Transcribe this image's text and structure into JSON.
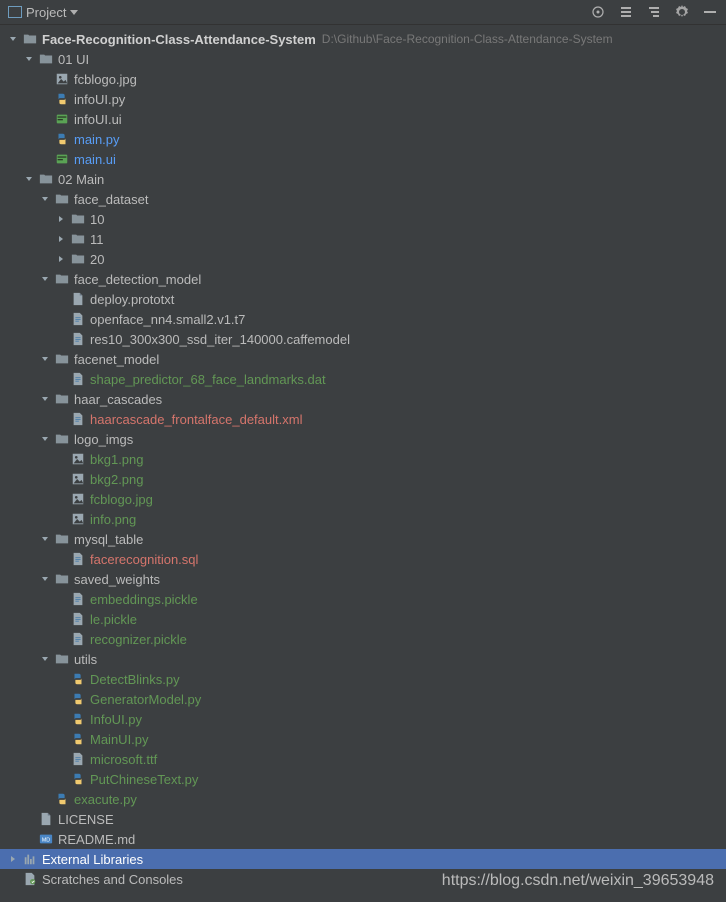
{
  "toolbar": {
    "title": "Project",
    "icons": {
      "target": "target-icon",
      "collapse": "collapse-all-icon",
      "expand": "expand-all-icon",
      "settings": "gear-icon",
      "hide": "hide-icon"
    }
  },
  "watermark": "https://blog.csdn.net/weixin_39653948",
  "tree": [
    {
      "d": 0,
      "exp": "open",
      "icon": "folder",
      "name": "Face-Recognition-Class-Attendance-System",
      "bold": true,
      "hint": "D:\\Github\\Face-Recognition-Class-Attendance-System"
    },
    {
      "d": 1,
      "exp": "open",
      "icon": "folder",
      "name": "01 UI"
    },
    {
      "d": 2,
      "exp": "none",
      "icon": "jpg",
      "name": "fcblogo.jpg"
    },
    {
      "d": 2,
      "exp": "none",
      "icon": "py",
      "name": "infoUI.py"
    },
    {
      "d": 2,
      "exp": "none",
      "icon": "ui",
      "name": "infoUI.ui"
    },
    {
      "d": 2,
      "exp": "none",
      "icon": "py",
      "name": "main.py",
      "cls": "hl"
    },
    {
      "d": 2,
      "exp": "none",
      "icon": "ui",
      "name": "main.ui",
      "cls": "hl"
    },
    {
      "d": 1,
      "exp": "open",
      "icon": "folder",
      "name": "02 Main"
    },
    {
      "d": 2,
      "exp": "open",
      "icon": "folder",
      "name": "face_dataset"
    },
    {
      "d": 3,
      "exp": "closed",
      "icon": "folder",
      "name": "10"
    },
    {
      "d": 3,
      "exp": "closed",
      "icon": "folder",
      "name": "11"
    },
    {
      "d": 3,
      "exp": "closed",
      "icon": "folder",
      "name": "20"
    },
    {
      "d": 2,
      "exp": "open",
      "icon": "folder",
      "name": "face_detection_model"
    },
    {
      "d": 3,
      "exp": "none",
      "icon": "file",
      "name": "deploy.prototxt"
    },
    {
      "d": 3,
      "exp": "none",
      "icon": "bin",
      "name": "openface_nn4.small2.v1.t7"
    },
    {
      "d": 3,
      "exp": "none",
      "icon": "bin",
      "name": "res10_300x300_ssd_iter_140000.caffemodel"
    },
    {
      "d": 2,
      "exp": "open",
      "icon": "folder",
      "name": "facenet_model"
    },
    {
      "d": 3,
      "exp": "none",
      "icon": "bin",
      "name": "shape_predictor_68_face_landmarks.dat",
      "cls": "git-new"
    },
    {
      "d": 2,
      "exp": "open",
      "icon": "folder",
      "name": "haar_cascades"
    },
    {
      "d": 3,
      "exp": "none",
      "icon": "bin",
      "name": "haarcascade_frontalface_default.xml",
      "cls": "git-conflict"
    },
    {
      "d": 2,
      "exp": "open",
      "icon": "folder",
      "name": "logo_imgs"
    },
    {
      "d": 3,
      "exp": "none",
      "icon": "jpg",
      "name": "bkg1.png",
      "cls": "git-new"
    },
    {
      "d": 3,
      "exp": "none",
      "icon": "jpg",
      "name": "bkg2.png",
      "cls": "git-new"
    },
    {
      "d": 3,
      "exp": "none",
      "icon": "jpg",
      "name": "fcblogo.jpg",
      "cls": "git-new"
    },
    {
      "d": 3,
      "exp": "none",
      "icon": "jpg",
      "name": "info.png",
      "cls": "git-new"
    },
    {
      "d": 2,
      "exp": "open",
      "icon": "folder",
      "name": "mysql_table"
    },
    {
      "d": 3,
      "exp": "none",
      "icon": "bin",
      "name": "facerecognition.sql",
      "cls": "git-conflict"
    },
    {
      "d": 2,
      "exp": "open",
      "icon": "folder",
      "name": "saved_weights"
    },
    {
      "d": 3,
      "exp": "none",
      "icon": "bin",
      "name": "embeddings.pickle",
      "cls": "git-new"
    },
    {
      "d": 3,
      "exp": "none",
      "icon": "bin",
      "name": "le.pickle",
      "cls": "git-new"
    },
    {
      "d": 3,
      "exp": "none",
      "icon": "bin",
      "name": "recognizer.pickle",
      "cls": "git-new"
    },
    {
      "d": 2,
      "exp": "open",
      "icon": "folder",
      "name": "utils"
    },
    {
      "d": 3,
      "exp": "none",
      "icon": "py",
      "name": "DetectBlinks.py",
      "cls": "git-new"
    },
    {
      "d": 3,
      "exp": "none",
      "icon": "py",
      "name": "GeneratorModel.py",
      "cls": "git-new"
    },
    {
      "d": 3,
      "exp": "none",
      "icon": "py",
      "name": "InfoUI.py",
      "cls": "git-new"
    },
    {
      "d": 3,
      "exp": "none",
      "icon": "py",
      "name": "MainUI.py",
      "cls": "git-new"
    },
    {
      "d": 3,
      "exp": "none",
      "icon": "bin",
      "name": "microsoft.ttf",
      "cls": "git-new"
    },
    {
      "d": 3,
      "exp": "none",
      "icon": "py",
      "name": "PutChineseText.py",
      "cls": "git-new"
    },
    {
      "d": 2,
      "exp": "none",
      "icon": "py",
      "name": "exacute.py",
      "cls": "git-new"
    },
    {
      "d": 1,
      "exp": "none",
      "icon": "file",
      "name": "LICENSE"
    },
    {
      "d": 1,
      "exp": "none",
      "icon": "md",
      "name": "README.md"
    },
    {
      "d": 0,
      "exp": "closed",
      "icon": "lib",
      "name": "External Libraries",
      "selected": true
    },
    {
      "d": 0,
      "exp": "none",
      "icon": "scratch",
      "name": "Scratches and Consoles"
    }
  ]
}
